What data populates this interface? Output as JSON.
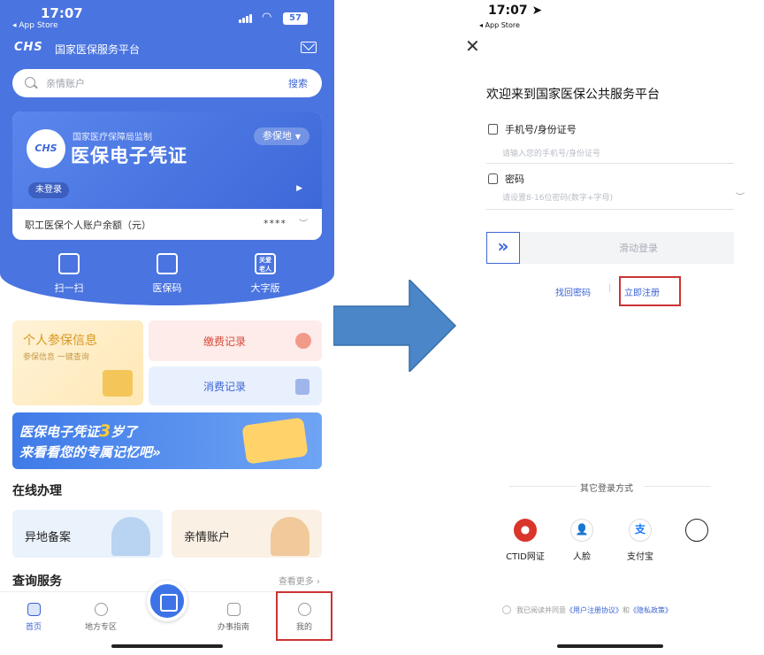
{
  "left": {
    "status": {
      "time": "17:07",
      "back": "◂ App Store",
      "battery": "57"
    },
    "brand": {
      "logo": "CHS",
      "name": "国家医保服务平台"
    },
    "search": {
      "placeholder": "亲情账户",
      "button": "搜索"
    },
    "card": {
      "logo": "CHS",
      "supervisor": "国家医疗保障局监制",
      "title": "医保电子凭证",
      "location": "参保地",
      "login_status": "未登录",
      "balance_label": "职工医保个人账户余额（元）",
      "balance_value": "****"
    },
    "quick": [
      {
        "label": "扫一扫",
        "icon": "scan-icon",
        "glyph": ""
      },
      {
        "label": "医保码",
        "icon": "qr-code-icon",
        "glyph": ""
      },
      {
        "label": "大字版",
        "icon": "elder-mode-icon",
        "glyph": "关爱老人"
      }
    ],
    "info_tile": {
      "title": "个人参保信息",
      "subtitle": "参保信息 一键查询"
    },
    "payment": {
      "label": "缴费记录"
    },
    "consumption": {
      "label": "消费记录"
    },
    "banner": {
      "line1_pre": "医保电子凭证",
      "line1_num": "3",
      "line1_post": "岁了",
      "line2": "来看看您的专属记忆吧»"
    },
    "online": {
      "title": "在线办理",
      "items": [
        {
          "label": "异地备案"
        },
        {
          "label": "亲情账户"
        }
      ]
    },
    "query": {
      "title": "查询服务",
      "more": "查看更多 ›"
    },
    "tabs": [
      {
        "label": "首页",
        "icon": "home-icon"
      },
      {
        "label": "地方专区",
        "icon": "location-icon"
      },
      {
        "label": "办事指南",
        "icon": "guide-icon"
      },
      {
        "label": "我的",
        "icon": "profile-icon"
      }
    ]
  },
  "right": {
    "status": {
      "time": "17:07 ➤",
      "back": "◂ App Store"
    },
    "close": "✕",
    "welcome": "欢迎来到国家医保公共服务平台",
    "phone": {
      "label": "手机号/身份证号",
      "placeholder": "请输入您的手机号/身份证号"
    },
    "password": {
      "label": "密码",
      "placeholder": "请设置8-16位密码(数字+字母)"
    },
    "slider": {
      "knob": "»",
      "label": "滑动登录"
    },
    "links": {
      "forgot": "找回密码",
      "separator": "|",
      "register": "立即注册"
    },
    "other_methods": {
      "title": "其它登录方式",
      "options": [
        {
          "label": "CTID网证",
          "icon": "ctid-icon",
          "glyph": "●"
        },
        {
          "label": "人脸",
          "icon": "face-icon",
          "glyph": "👤"
        },
        {
          "label": "支付宝",
          "icon": "alipay-icon",
          "glyph": "支"
        },
        {
          "label": "",
          "icon": "apple-icon",
          "glyph": ""
        }
      ]
    },
    "agreement": {
      "prefix": "我已阅读并同意",
      "terms": "《用户注册协议》",
      "and": "和",
      "privacy": "《隐私政策》"
    }
  },
  "colors": {
    "primary": "#4a74e0",
    "highlight": "#cc3333",
    "arrow": "#4a86c8"
  }
}
